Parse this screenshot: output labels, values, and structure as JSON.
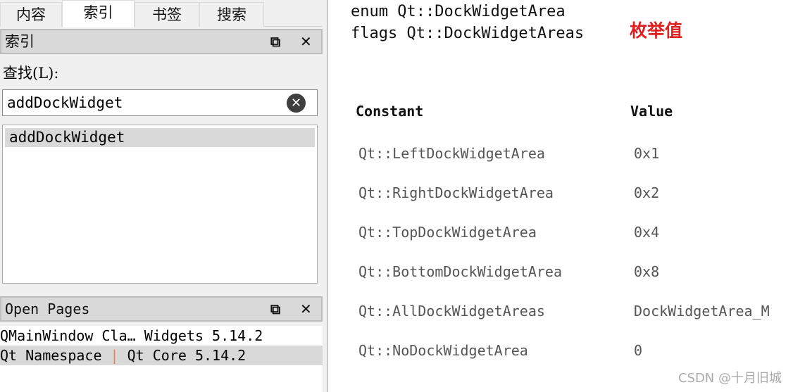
{
  "tabs": [
    "内容",
    "索引",
    "书签",
    "搜索"
  ],
  "index_panel": {
    "title": "索引",
    "find_label": "查找(L):",
    "search_value": "addDockWidget",
    "results": [
      "addDockWidget"
    ]
  },
  "open_pages": {
    "title": "Open Pages",
    "items": [
      {
        "left": "QMainWindow Cla…",
        "right": "Widgets 5.14.2"
      },
      {
        "left": "Qt Namespace",
        "right": "Qt Core 5.14.2"
      }
    ]
  },
  "doc": {
    "line1": "enum Qt::DockWidgetArea",
    "line2": "flags Qt::DockWidgetAreas",
    "annotation": "枚举值",
    "headers": [
      "Constant",
      "Value"
    ],
    "rows": [
      [
        "Qt::LeftDockWidgetArea",
        "0x1"
      ],
      [
        "Qt::RightDockWidgetArea",
        "0x2"
      ],
      [
        "Qt::TopDockWidgetArea",
        "0x4"
      ],
      [
        "Qt::BottomDockWidgetArea",
        "0x8"
      ],
      [
        "Qt::AllDockWidgetAreas",
        "DockWidgetArea_M"
      ],
      [
        "Qt::NoDockWidgetArea",
        "0"
      ]
    ]
  },
  "watermark": "CSDN @十月旧城",
  "colors": {
    "annotation": "#e02020"
  }
}
